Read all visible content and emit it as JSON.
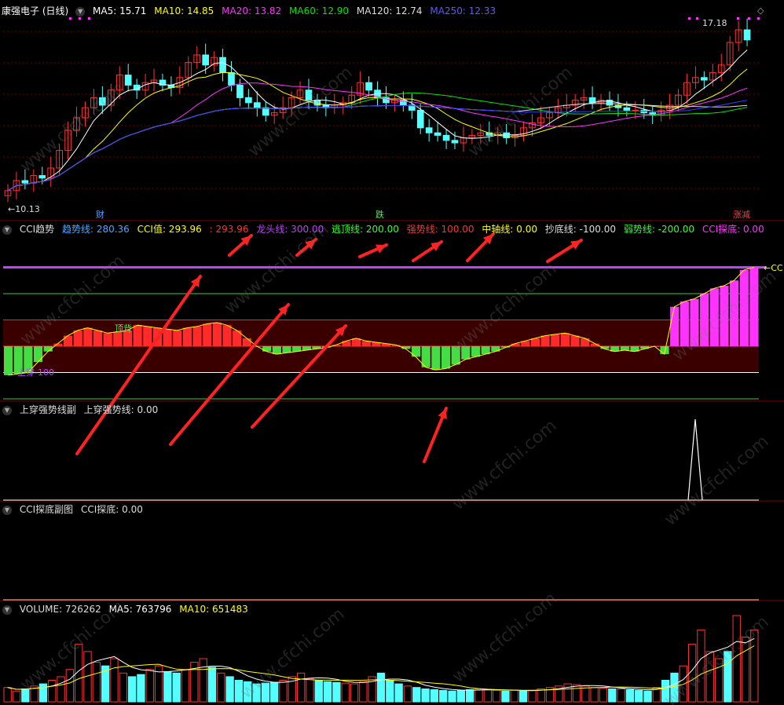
{
  "colors": {
    "up": "#ff3232",
    "down": "#54ffff",
    "ma5": "#ffffff",
    "ma10": "#ffff00",
    "ma20": "#ff33ff",
    "ma60": "#00e600",
    "ma120": "#dddddd",
    "ma250": "#3a3aff",
    "grid": "#7a0000"
  },
  "price_panel": {
    "title": "康强电子 (日线)",
    "ma": [
      {
        "label": "MA5: 15.71",
        "color": "#ffffff"
      },
      {
        "label": "MA10: 14.85",
        "color": "#ffff00"
      },
      {
        "label": "MA20: 13.82",
        "color": "#ff33ff"
      },
      {
        "label": "MA60: 12.90",
        "color": "#00e600"
      },
      {
        "label": "MA120: 12.74",
        "color": "#dddddd"
      },
      {
        "label": "MA250: 12.33",
        "color": "#3a3aff"
      }
    ],
    "high_label": "17.18",
    "low_label": "←10.13",
    "markers": [
      {
        "text": "财",
        "color": "#5aa0ff"
      },
      {
        "text": "跌",
        "color": "#33ff33"
      },
      {
        "text": "涨减",
        "color": "#ff4040"
      }
    ]
  },
  "cci_panel": {
    "items": [
      {
        "label": "CCI趋势",
        "color": "#dddddd"
      },
      {
        "label": "趋势线: 280.36",
        "color": "#4aa8ff"
      },
      {
        "label": "CCI值: 293.96",
        "color": "#ffff00"
      },
      {
        "label": ": 293.96",
        "color": "#ff3333"
      },
      {
        "label": "龙头线: 300.00",
        "color": "#c040ff"
      },
      {
        "label": "逃顶线: 200.00",
        "color": "#33ff33"
      },
      {
        "label": "强势线: 100.00",
        "color": "#ff3333"
      },
      {
        "label": "中轴线: 0.00",
        "color": "#ffff00"
      },
      {
        "label": "抄底线: -100.00",
        "color": "#dddddd"
      },
      {
        "label": "弱势线: -200.00",
        "color": "#33ff33"
      },
      {
        "label": "CCI探底: 0.00",
        "color": "#ff33ff"
      }
    ],
    "annot_top": "顶背",
    "annot_bottom": "上穿-100",
    "right_tag": "←CC"
  },
  "sub1_panel": {
    "title": "上穿强势线副",
    "value": "上穿强势线: 0.00"
  },
  "sub2_panel": {
    "title": "CCI探底副图",
    "value": "CCI探底: 0.00"
  },
  "volume_panel": {
    "items": [
      {
        "label": "VOLUME: 726262",
        "color": "#dddddd"
      },
      {
        "label": "MA5: 763796",
        "color": "#ffffff"
      },
      {
        "label": "MA10: 651483",
        "color": "#ffff00"
      }
    ]
  },
  "watermark": "www.cfchi.com",
  "chart_data": {
    "type": "candlestick",
    "description_series": "daily OHLC approx",
    "closes": [
      10.6,
      11.0,
      10.9,
      11.2,
      11.1,
      11.5,
      12.2,
      13.0,
      13.5,
      13.9,
      14.3,
      14.0,
      14.6,
      15.2,
      14.8,
      14.6,
      14.9,
      15.0,
      14.8,
      14.7,
      15.1,
      15.7,
      16.0,
      15.6,
      15.9,
      15.3,
      14.8,
      14.3,
      14.1,
      13.9,
      13.6,
      13.7,
      13.9,
      14.3,
      14.6,
      14.2,
      14.0,
      13.9,
      14.0,
      14.1,
      14.4,
      14.9,
      14.6,
      14.3,
      14.1,
      14.2,
      14.0,
      13.8,
      13.1,
      12.9,
      12.8,
      12.6,
      12.5,
      12.7,
      12.8,
      12.9,
      12.8,
      12.9,
      12.7,
      12.8,
      13.1,
      13.3,
      13.5,
      13.7,
      13.9,
      14.0,
      14.2,
      14.3,
      14.1,
      14.2,
      14.0,
      13.9,
      13.8,
      13.8,
      13.7,
      13.6,
      13.8,
      14.0,
      14.4,
      14.9,
      15.1,
      15.0,
      15.3,
      15.6,
      16.5,
      17.0,
      16.6
    ],
    "cci": [
      -110,
      -105,
      -100,
      -60,
      -20,
      10,
      40,
      60,
      70,
      60,
      50,
      55,
      60,
      80,
      75,
      70,
      65,
      60,
      70,
      75,
      85,
      90,
      80,
      60,
      30,
      0,
      -20,
      -30,
      -25,
      -20,
      -15,
      -10,
      -5,
      5,
      20,
      30,
      20,
      15,
      10,
      5,
      -10,
      -40,
      -80,
      -90,
      -85,
      -70,
      -50,
      -40,
      -30,
      -20,
      -5,
      10,
      20,
      30,
      40,
      45,
      50,
      40,
      30,
      10,
      -10,
      -20,
      -15,
      -20,
      -10,
      0,
      -30,
      150,
      170,
      180,
      200,
      220,
      230,
      250,
      290,
      300
    ],
    "volume": [
      20,
      15,
      18,
      22,
      25,
      30,
      35,
      45,
      80,
      70,
      55,
      50,
      60,
      40,
      35,
      38,
      45,
      50,
      42,
      40,
      45,
      55,
      60,
      48,
      40,
      35,
      30,
      28,
      25,
      26,
      27,
      30,
      35,
      40,
      32,
      30,
      28,
      27,
      26,
      25,
      28,
      35,
      40,
      30,
      25,
      22,
      20,
      18,
      17,
      16,
      15,
      16,
      17,
      18,
      17,
      16,
      15,
      16,
      15,
      16,
      18,
      20,
      22,
      25,
      24,
      22,
      20,
      19,
      18,
      18,
      17,
      16,
      15,
      20,
      30,
      40,
      50,
      80,
      100,
      70,
      60,
      70,
      120,
      90,
      100
    ],
    "ylim": [
      10,
      17.5
    ],
    "cci_levels": [
      300,
      200,
      100,
      0,
      -100,
      -200
    ]
  }
}
